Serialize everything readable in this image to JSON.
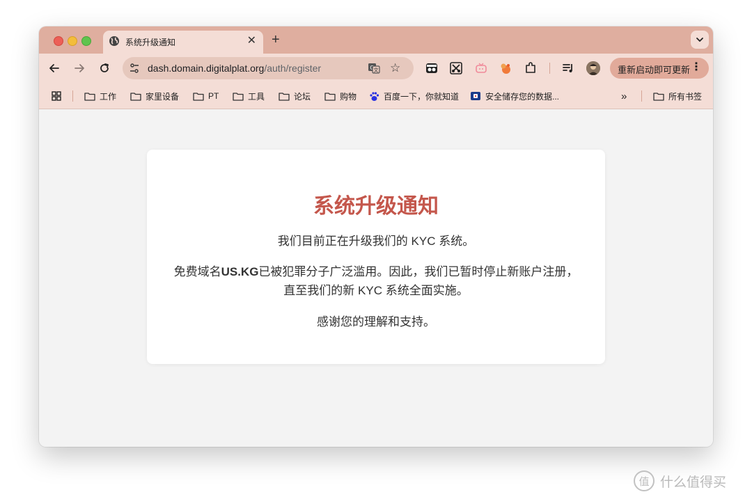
{
  "browser": {
    "tab": {
      "title": "系统升级通知",
      "close": "✕"
    },
    "new_tab": "+",
    "address": {
      "host": "dash.domain.digitalplat.org",
      "path": "/auth/register"
    },
    "update_button": "重新启动即可更新",
    "menu_dots": "⋮"
  },
  "bookmarks": {
    "items": [
      "工作",
      "家里设备",
      "PT",
      "工具",
      "论坛",
      "购物",
      "百度一下，你就知道",
      "安全储存您的数据..."
    ],
    "overflow": "»",
    "all_bookmarks": "所有书签"
  },
  "notice": {
    "title": "系统升级通知",
    "line1": "我们目前正在升级我们的 KYC 系统。",
    "line2_pre": "免费域名",
    "line2_domain": "US.KG",
    "line2_post": "已被犯罪分子广泛滥用。因此，我们已暂时停止新账户注册，直至我们的新 KYC 系统全面实施。",
    "line3": "感谢您的理解和支持。"
  },
  "watermark": {
    "seal": "值",
    "text": "什么值得买"
  },
  "colors": {
    "tabbar": "#dfae9f",
    "toolbar": "#f4ddd6",
    "title_red": "#c4574c"
  }
}
